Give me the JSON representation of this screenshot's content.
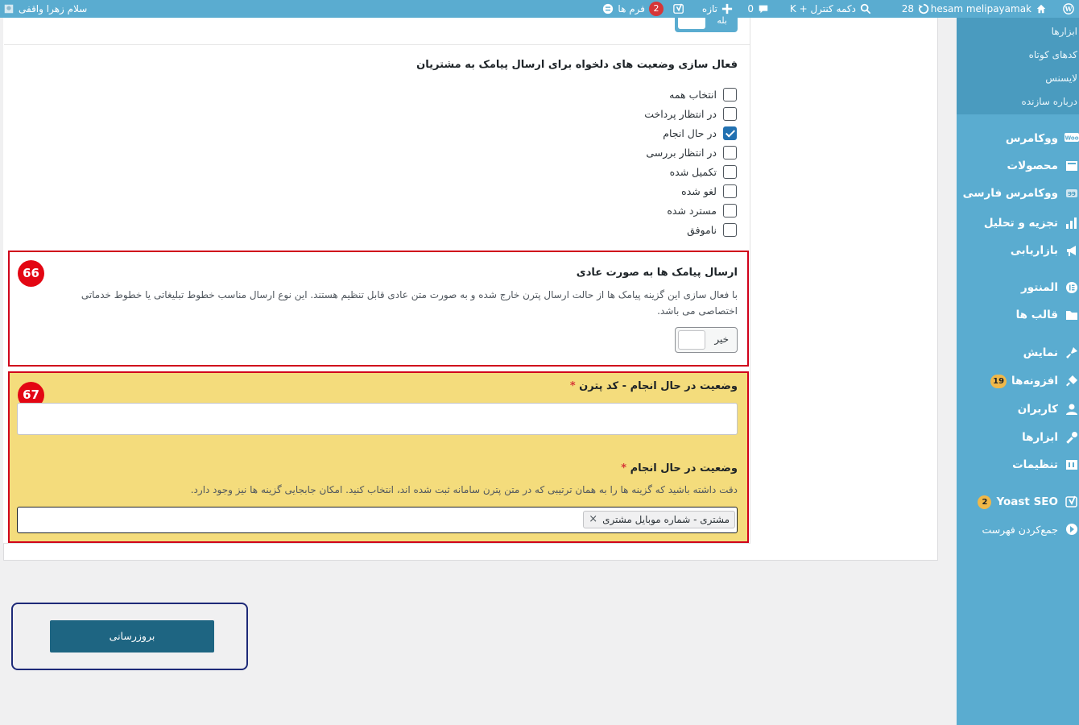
{
  "admin_bar": {
    "site_name": "hesam melipayamak",
    "updates_count": "28",
    "control_button": "دکمه کنترل + K",
    "comments_count": "0",
    "new_label": "تازه",
    "forms_label": "فرم ها",
    "forms_count": "2",
    "greeting": "سلام زهرا واقفی"
  },
  "sidebar": {
    "submenu": [
      "ابزارها",
      "کدهای کوتاه",
      "لایسنس",
      "درباره سازنده"
    ],
    "items": [
      {
        "label": "ووکامرس",
        "icon": "woocommerce-icon"
      },
      {
        "label": "محصولات",
        "icon": "products-icon"
      },
      {
        "label": "ووکامرس فارسی",
        "icon": "persian-woocommerce-icon"
      },
      {
        "label": "تجزیه و تحلیل",
        "icon": "analytics-icon"
      },
      {
        "label": "بازاریابی",
        "icon": "marketing-icon"
      },
      {
        "label": "المنتور",
        "icon": "elementor-icon"
      },
      {
        "label": "قالب ها",
        "icon": "templates-icon"
      },
      {
        "label": "نمایش",
        "icon": "appearance-icon"
      },
      {
        "label": "افزونه‌ها",
        "icon": "plugins-icon",
        "badge": "19"
      },
      {
        "label": "کاربران",
        "icon": "users-icon"
      },
      {
        "label": "ابزارها",
        "icon": "tools-icon"
      },
      {
        "label": "تنظیمات",
        "icon": "settings-icon"
      },
      {
        "label": "Yoast SEO",
        "icon": "yoast-icon",
        "badge": "2"
      },
      {
        "label": "جمع‌کردن فهرست",
        "icon": "collapse-icon"
      }
    ]
  },
  "main": {
    "top_toggle_label": "بله",
    "status_section_title": "فعال سازی وضعیت های دلخواه برای ارسال پیامک به مشتریان",
    "statuses": [
      {
        "label": "انتخاب همه",
        "checked": false
      },
      {
        "label": "در انتظار پرداخت",
        "checked": false
      },
      {
        "label": "در حال انجام",
        "checked": true
      },
      {
        "label": "در انتظار بررسی",
        "checked": false
      },
      {
        "label": "تکمیل شده",
        "checked": false
      },
      {
        "label": "لغو شده",
        "checked": false
      },
      {
        "label": "مسترد شده",
        "checked": false
      },
      {
        "label": "ناموفق",
        "checked": false
      }
    ],
    "normal_sms": {
      "badge": "66",
      "title": "ارسال پیامک ها به صورت عادی",
      "desc_line1": "با فعال سازی این گزینه پیامک ها از حالت ارسال پترن خارج شده و به صورت متن عادی قابل تنظیم هستند. این نوع ارسال مناسب خطوط تبلیغاتی یا خطوط خدماتی",
      "desc_line2": "اختصاصی می باشد.",
      "toggle_label": "خیر"
    },
    "pattern": {
      "badge": "67",
      "code_label": "وضعیت در حال انجام - کد پترن",
      "code_value": "",
      "vars_label": "وضعیت در حال انجام",
      "vars_desc": "دقت داشته باشید که گزینه ها را به همان ترتیبی که در متن پترن سامانه ثبت شده اند، انتخاب کنید. امکان جابجایی گزینه ها نیز وجود دارد.",
      "selected_tag": "مشتری - شماره موبایل مشتری",
      "required_mark": "*"
    },
    "update_button": "بروزرسانی"
  }
}
